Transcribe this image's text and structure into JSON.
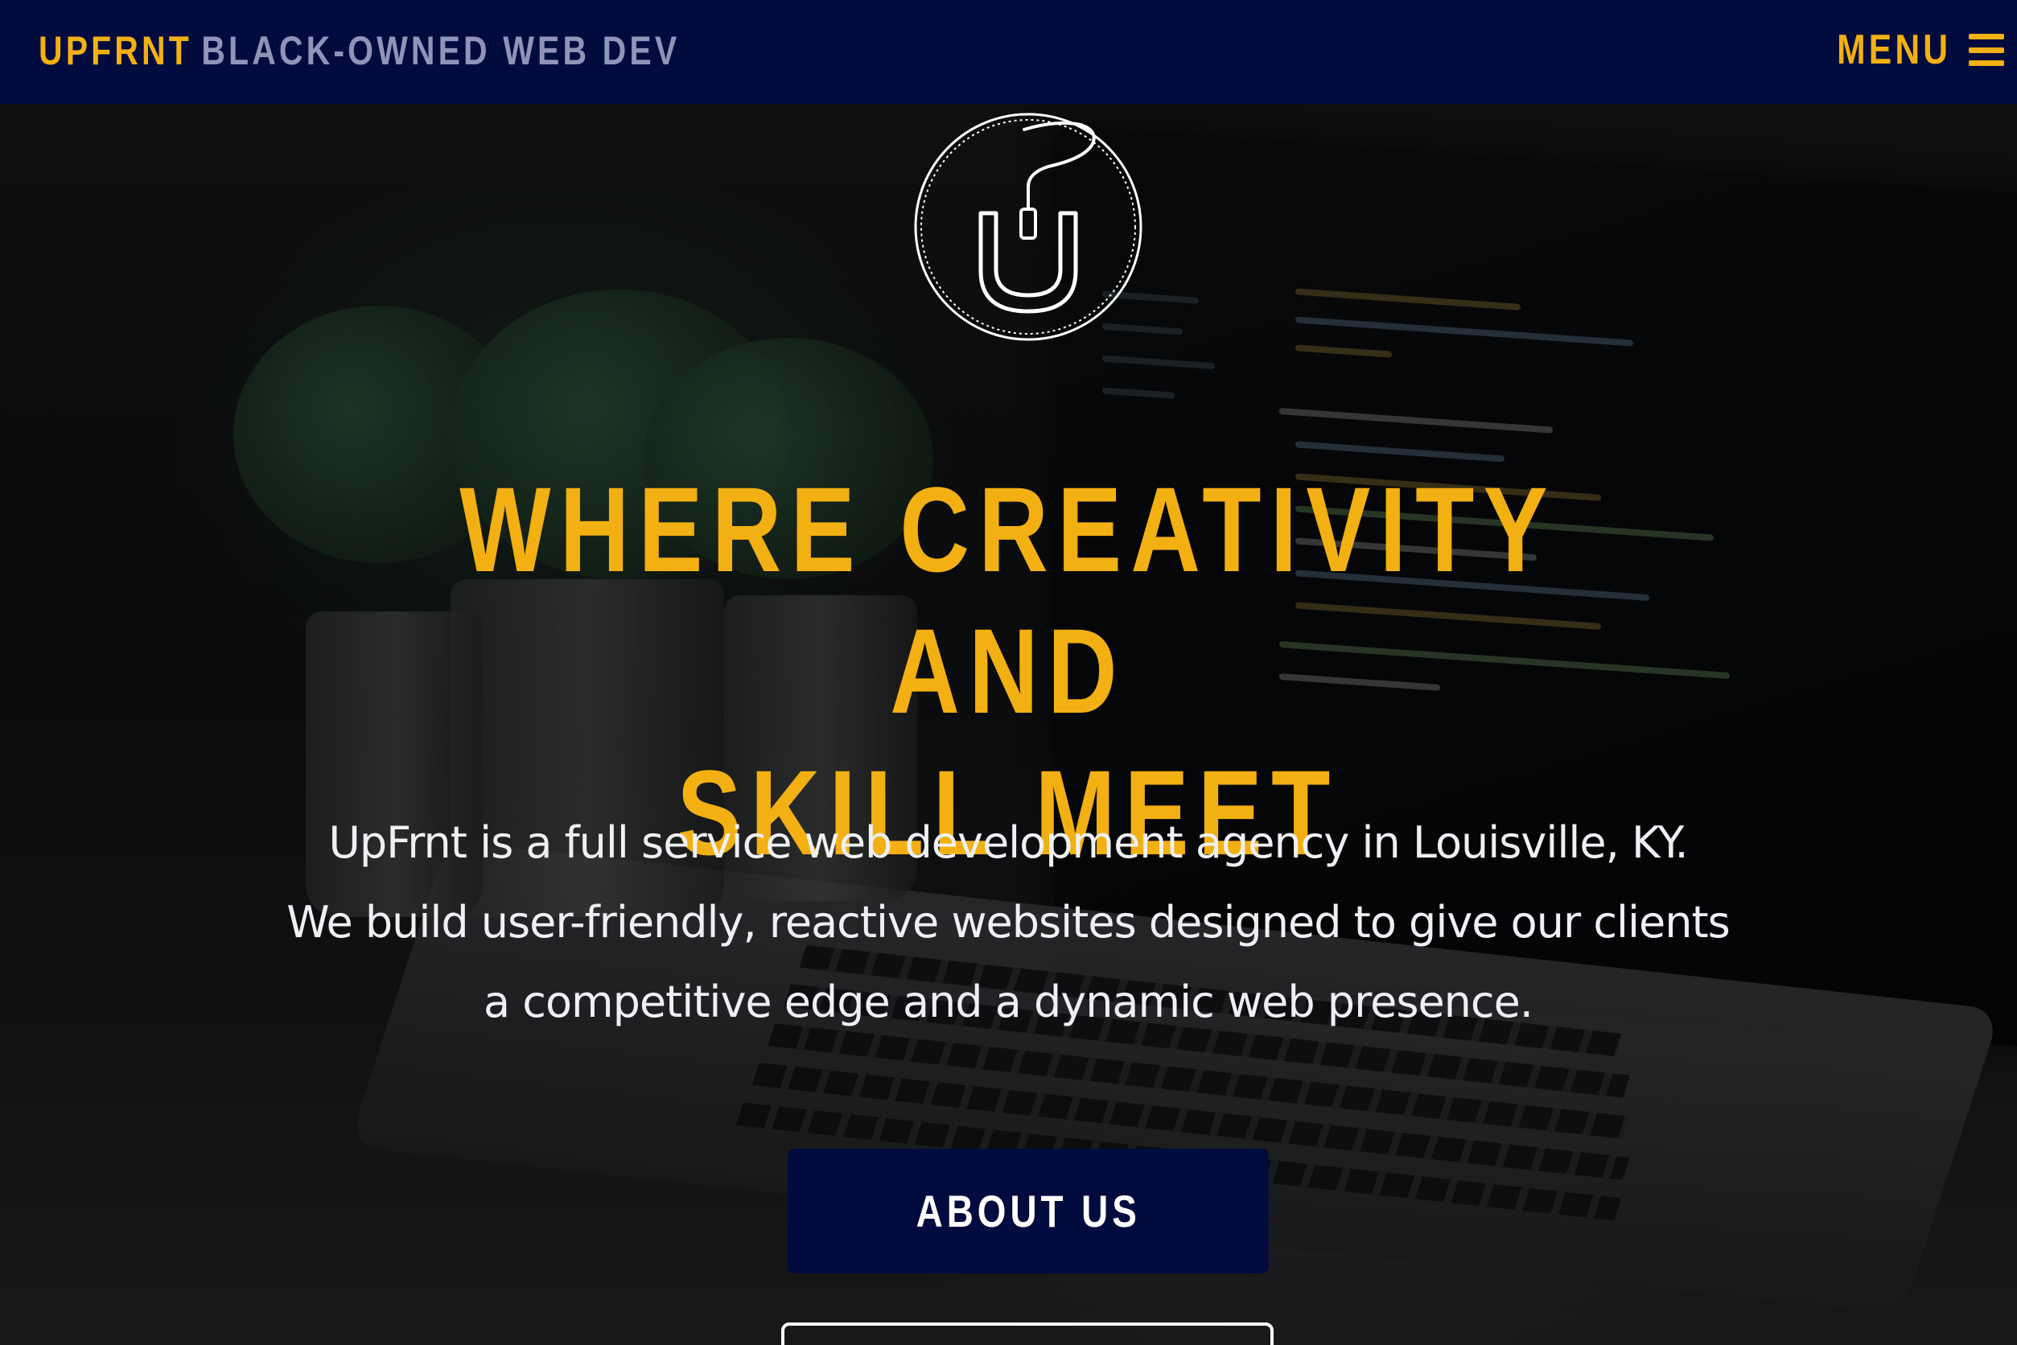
{
  "nav": {
    "brand_name": "UPFRNT",
    "brand_tagline": "BLACK-OWNED WEB DEV",
    "menu_label": "MENU",
    "menu_icon": "hamburger-icon"
  },
  "hero": {
    "logo_icon": "mouse-u-logo-icon",
    "headline_line1": "WHERE CREATIVITY AND",
    "headline_line2": "SKILL MEET",
    "intro_line1": "UpFrnt is a full service web development agency in Louisville, KY.",
    "intro_line2": "We build user-friendly, reactive websites designed to give our clients a competitive edge and a dynamic web presence.",
    "primary_button_label": "ABOUT US"
  },
  "colors": {
    "navy": "#020b3e",
    "accent_yellow": "#f3b012",
    "tagline_gray": "#8f94b8",
    "text_white": "#eef0f4"
  }
}
